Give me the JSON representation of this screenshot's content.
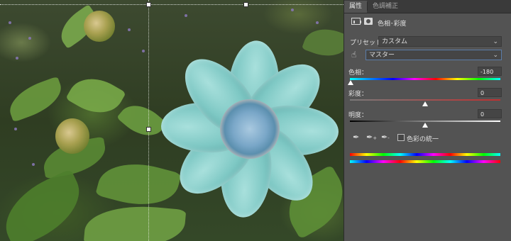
{
  "panel": {
    "tabs": [
      "属性",
      "色調補正"
    ],
    "adjustment_title": "色相･彩度",
    "preset": {
      "label": "プリセット：",
      "value": "カスタム"
    },
    "channel": {
      "value": "マスター"
    },
    "hue": {
      "label": "色相：",
      "value": "-180",
      "level": 0.0
    },
    "saturation": {
      "label": "彩度：",
      "value": "0",
      "level": 0.5
    },
    "lightness": {
      "label": "明度：",
      "value": "0",
      "level": 0.5
    },
    "colorize": {
      "label": "色彩の統一",
      "checked": false
    }
  },
  "icons": {
    "layer_icon": "adjustment-layer-icon",
    "mask_icon": "mask-icon",
    "hand_icon": "targeted-adjustment-hand-icon",
    "eyedroppers": [
      "eyedropper-icon",
      "eyedropper-plus-icon",
      "eyedropper-minus-icon"
    ]
  },
  "colors": {
    "panel_bg": "#535353",
    "tab_bar": "#3a3a3a",
    "flower": "#7ec8c4"
  }
}
